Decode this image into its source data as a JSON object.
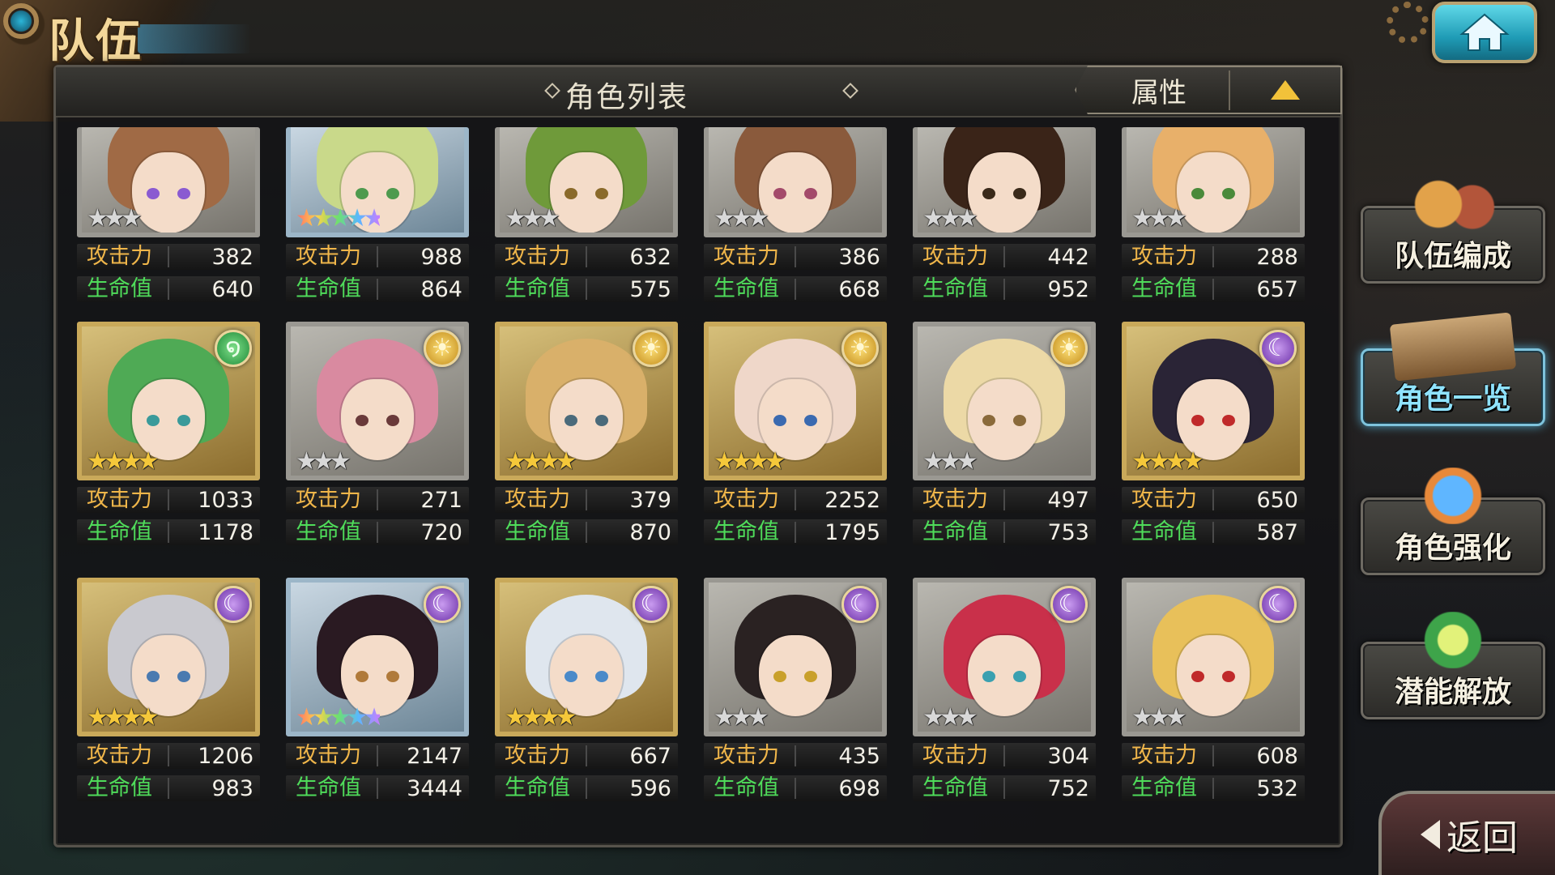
{
  "header": {
    "title": "队伍",
    "home_icon": "home-icon"
  },
  "panel": {
    "title": "角色列表",
    "sort_label": "属性",
    "sort_icon": "triangle-up-icon"
  },
  "characters": [
    {
      "atk_label": "攻击力",
      "atk": "382",
      "hp_label": "生命值",
      "hp": "640",
      "stars": "★★★",
      "star_style": "silver",
      "attribute": "",
      "frame": "silver",
      "hair": "#a06a45",
      "eye": "#8a5ad1"
    },
    {
      "atk_label": "攻击力",
      "atk": "988",
      "hp_label": "生命值",
      "hp": "864",
      "stars": "★★★★★",
      "star_style": "rainbow",
      "attribute": "",
      "frame": "blue",
      "hair": "#c9d98a",
      "eye": "#4e9a4e"
    },
    {
      "atk_label": "攻击力",
      "atk": "632",
      "hp_label": "生命值",
      "hp": "575",
      "stars": "★★★",
      "star_style": "silver",
      "attribute": "",
      "frame": "silver",
      "hair": "#6f9a3a",
      "eye": "#8a6a2a"
    },
    {
      "atk_label": "攻击力",
      "atk": "386",
      "hp_label": "生命值",
      "hp": "668",
      "stars": "★★★",
      "star_style": "silver",
      "attribute": "",
      "frame": "silver",
      "hair": "#8a5a3c",
      "eye": "#a34a6a"
    },
    {
      "atk_label": "攻击力",
      "atk": "442",
      "hp_label": "生命值",
      "hp": "952",
      "stars": "★★★",
      "star_style": "silver",
      "attribute": "",
      "frame": "silver",
      "hair": "#3a2418",
      "eye": "#3a2a1a"
    },
    {
      "atk_label": "攻击力",
      "atk": "288",
      "hp_label": "生命值",
      "hp": "657",
      "stars": "★★★",
      "star_style": "silver",
      "attribute": "",
      "frame": "silver",
      "hair": "#e8b06a",
      "eye": "#4a8a3a"
    },
    {
      "atk_label": "攻击力",
      "atk": "1033",
      "hp_label": "生命值",
      "hp": "1178",
      "stars": "★★★★",
      "star_style": "gold",
      "attribute": "wind",
      "frame": "gold",
      "hair": "#4faa55",
      "eye": "#3a9a9a"
    },
    {
      "atk_label": "攻击力",
      "atk": "271",
      "hp_label": "生命值",
      "hp": "720",
      "stars": "★★★",
      "star_style": "silver",
      "attribute": "sun",
      "frame": "silver",
      "hair": "#d98aa0",
      "eye": "#6a3a3a"
    },
    {
      "atk_label": "攻击力",
      "atk": "379",
      "hp_label": "生命值",
      "hp": "870",
      "stars": "★★★★",
      "star_style": "gold",
      "attribute": "sun",
      "frame": "gold",
      "hair": "#d9b06a",
      "eye": "#4a6a7a"
    },
    {
      "atk_label": "攻击力",
      "atk": "2252",
      "hp_label": "生命值",
      "hp": "1795",
      "stars": "★★★★",
      "star_style": "gold",
      "attribute": "sun",
      "frame": "gold",
      "hair": "#efd7c9",
      "eye": "#3a6ab0"
    },
    {
      "atk_label": "攻击力",
      "atk": "497",
      "hp_label": "生命值",
      "hp": "753",
      "stars": "★★★",
      "star_style": "silver",
      "attribute": "sun",
      "frame": "silver",
      "hair": "#ecd9a6",
      "eye": "#8a6a3a"
    },
    {
      "atk_label": "攻击力",
      "atk": "650",
      "hp_label": "生命值",
      "hp": "587",
      "stars": "★★★★",
      "star_style": "gold",
      "attribute": "moon",
      "frame": "gold",
      "hair": "#2a2436",
      "eye": "#c02a2a"
    },
    {
      "atk_label": "攻击力",
      "atk": "1206",
      "hp_label": "生命值",
      "hp": "983",
      "stars": "★★★★",
      "star_style": "gold",
      "attribute": "moon",
      "frame": "gold",
      "hair": "#c9c9cf",
      "eye": "#4a7ab0"
    },
    {
      "atk_label": "攻击力",
      "atk": "2147",
      "hp_label": "生命值",
      "hp": "3444",
      "stars": "★★★★★",
      "star_style": "rainbow",
      "attribute": "moon",
      "frame": "blue",
      "hair": "#2a1a22",
      "eye": "#b07a3a"
    },
    {
      "atk_label": "攻击力",
      "atk": "667",
      "hp_label": "生命值",
      "hp": "596",
      "stars": "★★★★",
      "star_style": "gold",
      "attribute": "moon",
      "frame": "gold",
      "hair": "#dfe6ee",
      "eye": "#4a8ac9"
    },
    {
      "atk_label": "攻击力",
      "atk": "435",
      "hp_label": "生命值",
      "hp": "698",
      "stars": "★★★",
      "star_style": "silver",
      "attribute": "moon",
      "frame": "silver",
      "hair": "#2a2222",
      "eye": "#c9a02a"
    },
    {
      "atk_label": "攻击力",
      "atk": "304",
      "hp_label": "生命值",
      "hp": "752",
      "stars": "★★★",
      "star_style": "silver",
      "attribute": "moon",
      "frame": "silver",
      "hair": "#c9304a",
      "eye": "#3aa0b0"
    },
    {
      "atk_label": "攻击力",
      "atk": "608",
      "hp_label": "生命值",
      "hp": "532",
      "stars": "★★★",
      "star_style": "silver",
      "attribute": "moon",
      "frame": "silver",
      "hair": "#e8c05a",
      "eye": "#c02a2a"
    }
  ],
  "attribute_icons": {
    "sun": "☀",
    "moon": "☾",
    "wind": "໑"
  },
  "side_menu": [
    {
      "label": "队伍编成",
      "icon": "team-icon",
      "active": false
    },
    {
      "label": "角色一览",
      "icon": "book-icon",
      "active": true
    },
    {
      "label": "角色强化",
      "icon": "upgrade-icon",
      "active": false
    },
    {
      "label": "潜能解放",
      "icon": "potential-icon",
      "active": false
    }
  ],
  "back_button": {
    "label": "返回",
    "icon": "back-arrow-icon"
  }
}
